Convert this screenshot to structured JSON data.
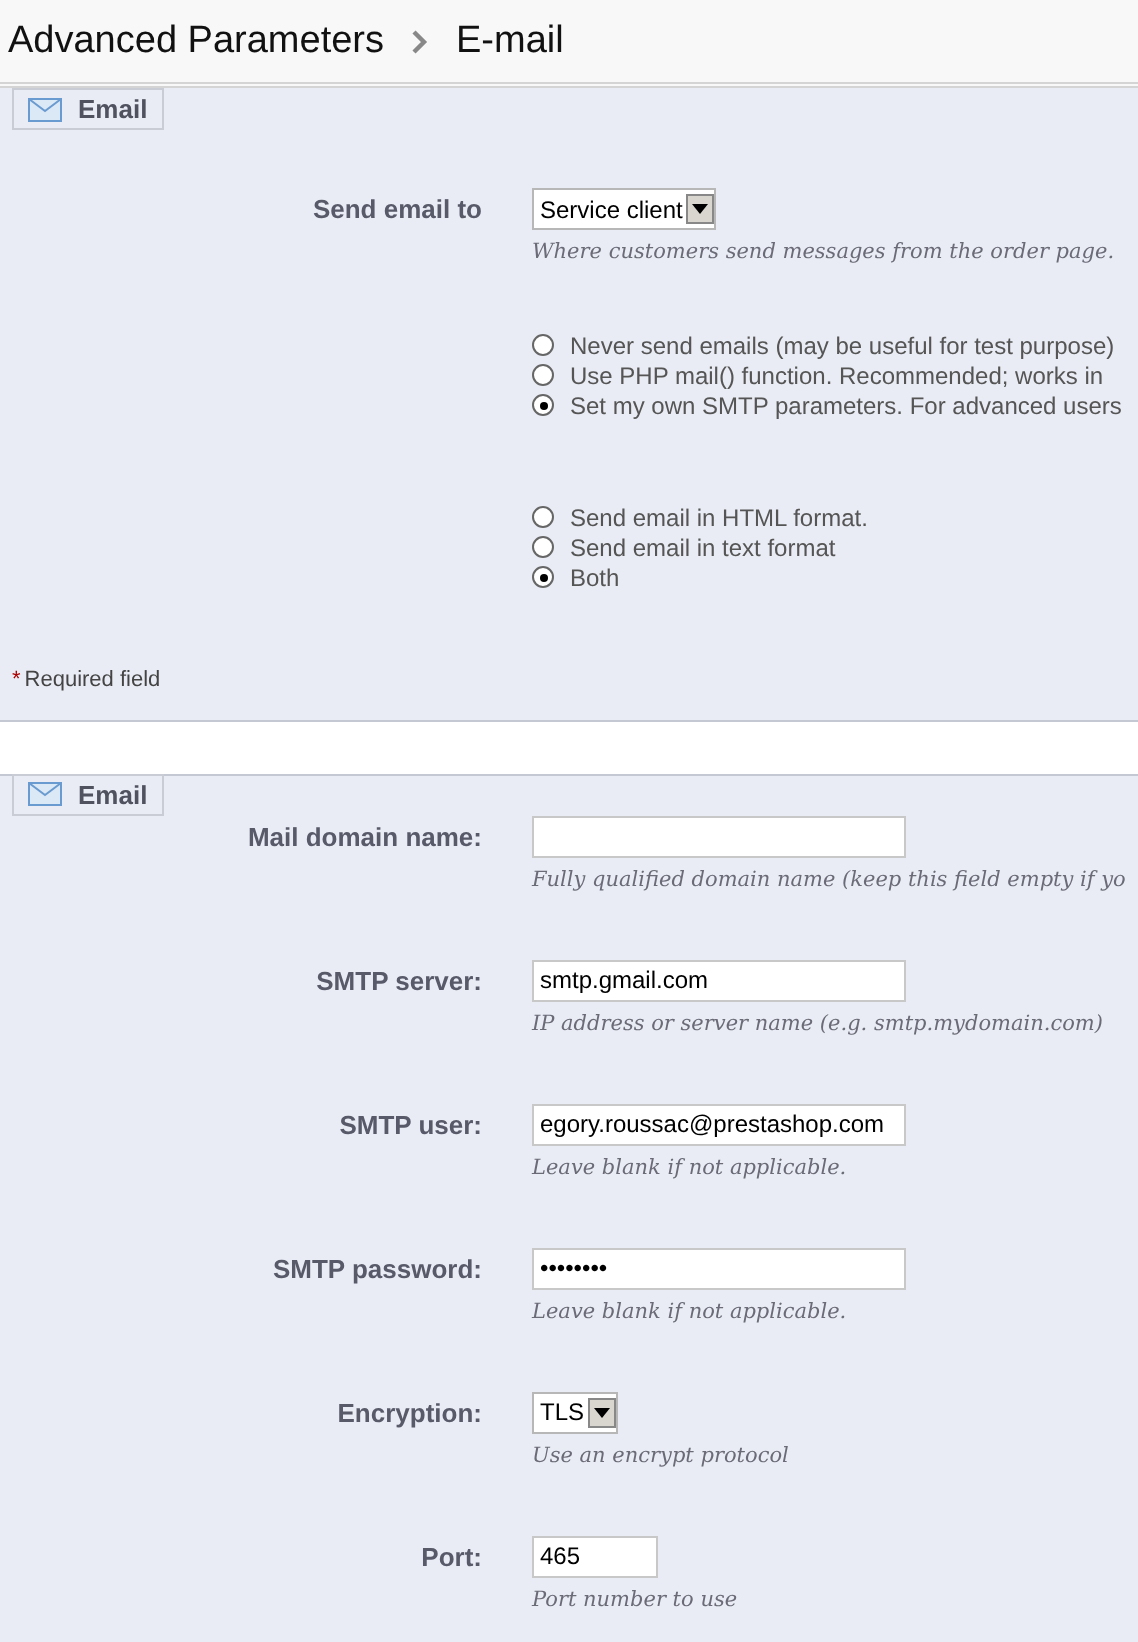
{
  "header": {
    "breadcrumb": [
      "Advanced Parameters",
      "E-mail"
    ]
  },
  "sections": [
    {
      "legend": "Email",
      "rows": [
        {
          "kind": "select",
          "label": "Send email to",
          "value": "Service client",
          "hint": "Where customers send messages from the order page."
        },
        {
          "kind": "radios",
          "options": [
            {
              "label": "Never send emails (may be useful for test purpose)",
              "selected": false
            },
            {
              "label": "Use PHP mail() function. Recommended; works in",
              "selected": false
            },
            {
              "label": "Set my own SMTP parameters. For advanced users",
              "selected": true
            }
          ]
        },
        {
          "kind": "radios",
          "options": [
            {
              "label": "Send email in HTML format.",
              "selected": false
            },
            {
              "label": "Send email in text format",
              "selected": false
            },
            {
              "label": "Both",
              "selected": true
            }
          ]
        }
      ],
      "required_mark": "*",
      "required_note": "Required field"
    },
    {
      "legend": "Email",
      "rows": [
        {
          "kind": "text",
          "label": "Mail domain name:",
          "value": "",
          "hint": "Fully qualified domain name (keep this field empty if yo"
        },
        {
          "kind": "text",
          "label": "SMTP server:",
          "value": "smtp.gmail.com",
          "hint": "IP address or server name (e.g. smtp.mydomain.com)"
        },
        {
          "kind": "text",
          "label": "SMTP user:",
          "value": "egory.roussac@prestashop.com",
          "hint": "Leave blank if not applicable."
        },
        {
          "kind": "text",
          "label": "SMTP password:",
          "value": "••••••••",
          "hint": "Leave blank if not applicable."
        },
        {
          "kind": "select",
          "label": "Encryption:",
          "value": "TLS",
          "hint": "Use an encrypt protocol"
        },
        {
          "kind": "short",
          "label": "Port:",
          "value": "465",
          "hint": "Port number to use"
        }
      ]
    }
  ]
}
